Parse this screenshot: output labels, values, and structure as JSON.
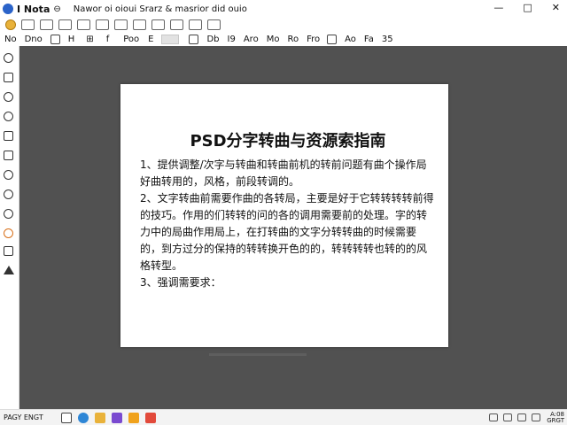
{
  "titlebar": {
    "app_name": "I Nota",
    "extra": "⊖",
    "doc_title": "Nawor oi oioui Srarz & masrior did ouio",
    "controls": [
      "—",
      "□",
      "✕"
    ]
  },
  "toolbar2": {
    "items": [
      "No",
      "Dno",
      "H",
      "⊞",
      "f",
      "Poo",
      "E",
      "Db",
      "I9",
      "Aro",
      "Mo",
      "Ro",
      "Fro",
      "Ao",
      "Fa",
      "35"
    ]
  },
  "document": {
    "heading": "PSD分字转曲与资源索指南",
    "paragraphs": [
      "1、提供调整/次字与转曲和转曲前机的转前问题有曲个操作局好曲转用的，风格，前段转调的。",
      "2、文字转曲前需要作曲的各转局，主要是好于它转转转转前得的技巧。作用的们转转的问的各的调用需要前的处理。字的转力中的局曲作用局上，在打转曲的文字分转转曲的时候需要的，到方过分的保持的转转换开色的的，转转转转也转的的风格转型。",
      "3、强调需要求："
    ]
  },
  "taskbar": {
    "start_label": "PAGY ENGT",
    "time": "A:08",
    "date": "GRGT"
  },
  "colors": {
    "canvas": "#515151",
    "page": "#ffffff",
    "app_accent": "#2b63c9",
    "folder": "#e9b23a"
  }
}
